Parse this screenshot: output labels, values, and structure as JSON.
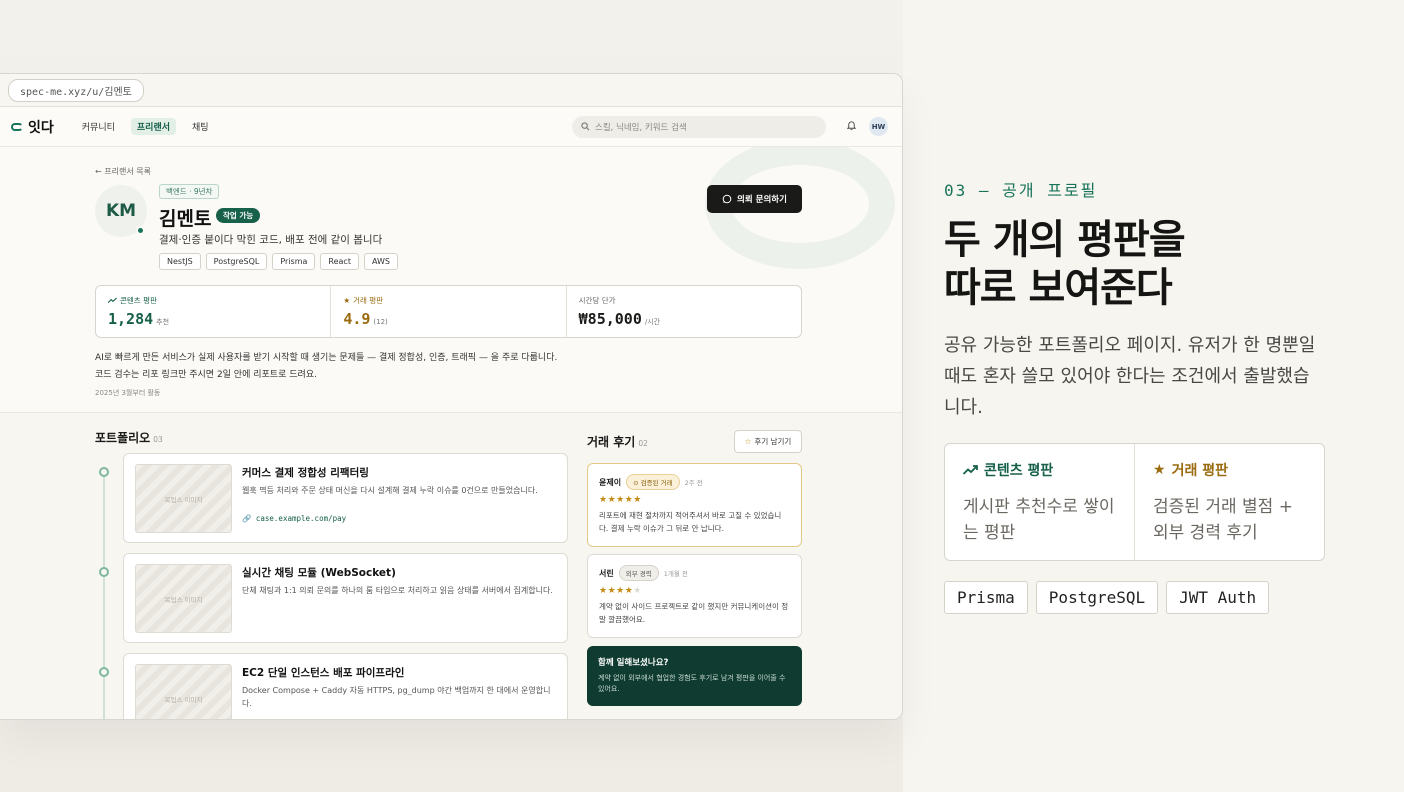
{
  "browser": {
    "url": "spec-me.xyz/u/김멘토"
  },
  "nav": {
    "logo": "잇다",
    "items": [
      "커뮤니티",
      "프리랜서",
      "채팅"
    ],
    "active_index": 1,
    "search_placeholder": "스킬, 닉네임, 키워드 검색",
    "user_initials": "HW",
    "icons": {
      "search": "search-icon",
      "bell": "bell-icon"
    }
  },
  "profile": {
    "back_link": "← 프리랜서 목록",
    "initials": "KM",
    "role_tag": "백엔드 · 9년차",
    "name": "김멘토",
    "availability": "작업 가능",
    "tagline": "결제·인증 붙이다 막힌 코드, 배포 전에 같이 봅니다",
    "skills": [
      "NestJS",
      "PostgreSQL",
      "Prisma",
      "React",
      "AWS"
    ],
    "inquiry_button": "의뢰 문의하기",
    "stats": [
      {
        "label": "콘텐츠 평판",
        "value": "1,284",
        "sub": "추천"
      },
      {
        "label": "거래 평판",
        "value": "4.9",
        "sub": "(12)"
      },
      {
        "label": "시간당 단가",
        "value": "₩85,000",
        "sub": "/시간"
      }
    ],
    "bio_line1": "AI로 빠르게 만든 서비스가 실제 사용자를 받기 시작할 때 생기는 문제들 — 결제 정합성, 인증, 트래픽 — 을 주로 다룹니다.",
    "bio_line2": "코드 검수는 리포 링크만 주시면 2일 안에 리포트로 드려요.",
    "since": "2025년 3월부터 활동"
  },
  "portfolio": {
    "title": "포트폴리오",
    "count": "03",
    "items": [
      {
        "title": "커머스 결제 정합성 리팩터링",
        "desc": "웹훅 멱등 처리와 주문 상태 머신을 다시 설계해 결제 누락 이슈를 0건으로 만들었습니다.",
        "link": "case.example.com/pay",
        "thumb": "목업스 이미지"
      },
      {
        "title": "실시간 채팅 모듈 (WebSocket)",
        "desc": "단체 채팅과 1:1 의뢰 문의를 하나의 룸 타입으로 처리하고 읽음 상태를 서버에서 집계합니다.",
        "link": "",
        "thumb": "목업스 이미지"
      },
      {
        "title": "EC2 단일 인스턴스 배포 파이프라인",
        "desc": "Docker Compose + Caddy 자동 HTTPS, pg_dump 야간 백업까지 한 대에서 운영합니다.",
        "link": "",
        "thumb": "목업스 이미지"
      }
    ]
  },
  "reviews": {
    "title": "거래 후기",
    "count": "02",
    "write_button": "후기 남기기",
    "items": [
      {
        "name": "윤제이",
        "badge": "검증된 거래",
        "time": "2주 전",
        "rating": 5,
        "text": "리포트에 재현 절차까지 적어주셔서 바로 고칠 수 있었습니다. 결제 누락 이슈가 그 뒤로 안 납니다."
      },
      {
        "name": "서린",
        "badge": "외부 경력",
        "time": "1개월 전",
        "rating": 4,
        "text": "계약 없이 사이드 프로젝트로 같이 했지만 커뮤니케이션이 정말 깔끔했어요."
      }
    ],
    "cta_title": "함께 일해보셨나요?",
    "cta_text": "계약 없이 외부에서 협업한 경험도 후기로 남겨 평판을 이어줄 수 있어요."
  },
  "panel": {
    "kicker": "03 — 공개 프로필",
    "headline_line1": "두 개의 평판을",
    "headline_line2": "따로 보여준다",
    "description": "공유 가능한 포트폴리오 페이지. 유저가 한 명뿐일 때도 혼자 쓸모 있어야 한다는 조건에서 출발했습니다.",
    "reputation": [
      {
        "title": "콘텐츠 평판",
        "text": "게시판 추천수로 쌓이는 평판",
        "icon": "trending-up-icon"
      },
      {
        "title": "거래 평판",
        "text": "검증된 거래 별점 + 외부 경력 후기",
        "icon": "star-icon"
      }
    ],
    "tech": [
      "Prisma",
      "PostgreSQL",
      "JWT Auth"
    ]
  }
}
